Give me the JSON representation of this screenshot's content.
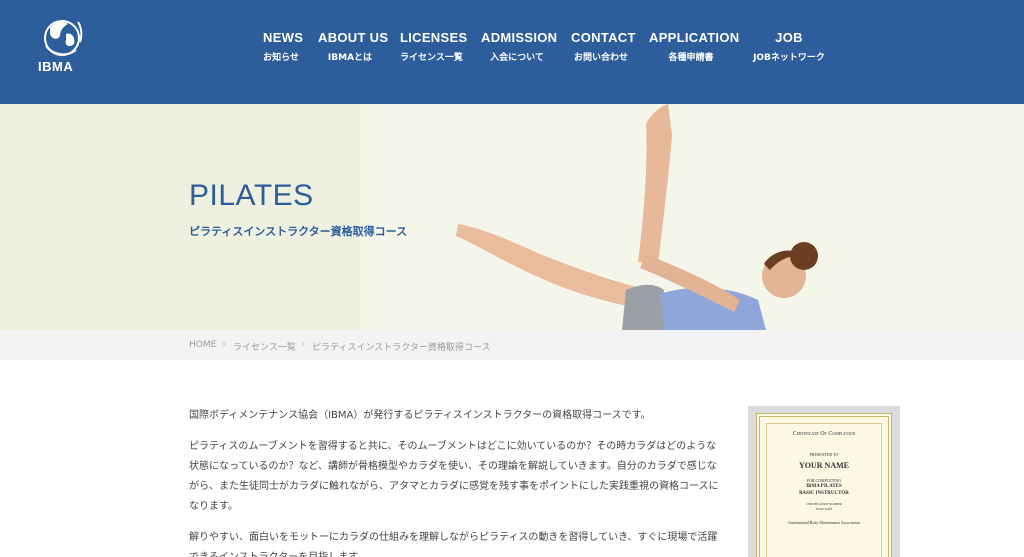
{
  "header": {
    "logo_text": "IBMA",
    "nav": [
      {
        "en": "NEWS",
        "ja": "お知らせ"
      },
      {
        "en": "ABOUT US",
        "ja": "IBMAとは"
      },
      {
        "en": "LICENSES",
        "ja": "ライセンス一覧"
      },
      {
        "en": "ADMISSION",
        "ja": "入会について"
      },
      {
        "en": "CONTACT",
        "ja": "お問い合わせ"
      },
      {
        "en": "APPLICATION",
        "ja": "各種申請書"
      },
      {
        "en": "JOB",
        "ja": "JOBネットワーク"
      }
    ]
  },
  "hero": {
    "title": "PILATES",
    "subtitle": "ピラティスインストラクター資格取得コース"
  },
  "breadcrumb": {
    "home": "HOME",
    "licenses": "ライセンス一覧",
    "current": "ピラティスインストラクター資格取得コース"
  },
  "content": {
    "paragraphs": [
      "国際ボディメンテナンス協会（IBMA）が発行するピラティスインストラクターの資格取得コースです。",
      "ピラティスのムーブメントを習得すると共に、そのムーブメントはどこに効いているのか？その時カラダはどのような状態になっているのか？など、講師が骨格模型やカラダを使い、その理論を解説していきます。自分のカラダで感じながら、また生徒同士がカラダに触れながら、アタマとカラダに感覚を残す事をポイントにした実践重視の資格コースになります。",
      "解りやすい、面白いをモットーにカラダの仕組みを理解しながらピラティスの動きを習得していき、すぐに現場で活躍できるインストラクターを目指します。"
    ]
  },
  "certificate": {
    "heading": "Certificate Of Completion",
    "presented": "PRESENTED TO",
    "name": "YOUR NAME",
    "for": "FOR COMPLETING",
    "course_line1": "IBMA PILATES",
    "course_line2": "BASIC INSTRUCTOR",
    "cert_no": "CERTIFICATION NUMBER",
    "issue": "ISSUE DATE",
    "org": "International Body Maintenance Association"
  },
  "colors": {
    "brand": "#2d5d9a",
    "hero_bg": "#eef1e0",
    "breadcrumb_bg": "#f3f3f3"
  }
}
